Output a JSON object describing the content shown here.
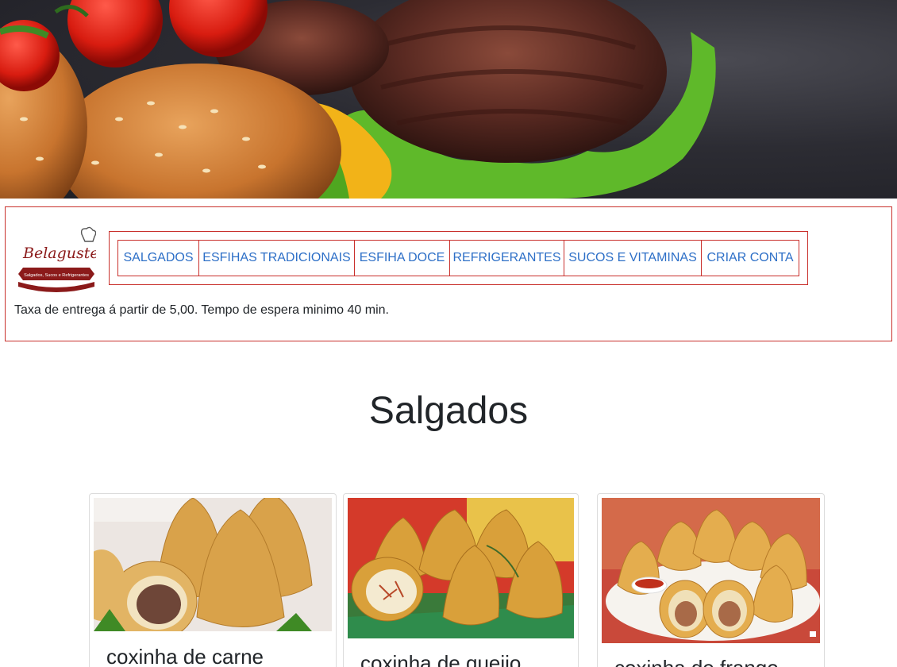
{
  "hero": {
    "image": "burger-hero-photo"
  },
  "logo": {
    "brand": "Belaguster",
    "tagline": "Salgados, Sucos e Refrigerantes"
  },
  "nav": {
    "items": [
      {
        "label": "SALGADOS"
      },
      {
        "label": "ESFIHAS TRADICIONAIS"
      },
      {
        "label": "ESFIHA DOCE"
      },
      {
        "label": "REFRIGERANTES"
      },
      {
        "label": "SUCOS E VITAMINAS"
      },
      {
        "label": "CRIAR CONTA"
      }
    ]
  },
  "notice": "Taxa de entrega á partir de 5,00. Tempo de espera minimo 40 min.",
  "section": {
    "title": "Salgados"
  },
  "products": [
    {
      "name": "coxinha de carne",
      "image": "coxinha-carne-photo"
    },
    {
      "name": "coxinha de queijo",
      "image": "coxinha-queijo-photo"
    },
    {
      "name": "coxinha de frango",
      "image": "coxinha-frango-photo"
    }
  ],
  "colors": {
    "accent_border": "#c9302c",
    "link": "#2d6fc7",
    "text": "#212529",
    "brand_red": "#8b1a1a"
  }
}
